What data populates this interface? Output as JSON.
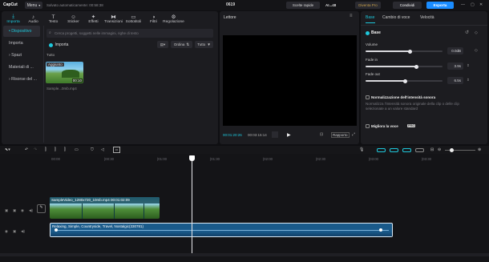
{
  "app": {
    "name": "CapCut",
    "menu": "Menu",
    "status": "Salvato automaticamente: 00:58:38",
    "project": "0619",
    "shortcuts": "Scelte rapide",
    "user": "AI...48",
    "pro": "Diventa Pro",
    "share": "Condividi",
    "export": "Esporta"
  },
  "toolbar": [
    {
      "label": "Importa",
      "icon": "download-icon"
    },
    {
      "label": "Audio",
      "icon": "audio-icon"
    },
    {
      "label": "Testo",
      "icon": "text-icon"
    },
    {
      "label": "Sticker",
      "icon": "sticker-icon"
    },
    {
      "label": "Effetti",
      "icon": "effects-icon"
    },
    {
      "label": "Transizioni",
      "icon": "transition-icon"
    },
    {
      "label": "Sottotitoli",
      "icon": "subtitles-icon"
    },
    {
      "label": "Filtri",
      "icon": "filter-icon"
    },
    {
      "label": "Regolazione",
      "icon": "adjust-icon"
    }
  ],
  "sidebar": [
    {
      "label": "• Dispositivo"
    },
    {
      "label": "Importa"
    },
    {
      "label": "› Spazi"
    },
    {
      "label": "Materiali di ..."
    },
    {
      "label": "› Risorse del ..."
    }
  ],
  "media": {
    "search_placeholder": "Cerca progetti, soggetti nelle immagini, righe di testo",
    "import": "Importa",
    "sort": "Ordina",
    "all": "Tutto",
    "filter": "Tutto",
    "added": "Aggiunto",
    "duration": "00:10",
    "filename": "Sample...0mb.mp4"
  },
  "player": {
    "title": "Lettore",
    "current": "00:01:20:26",
    "total": "00:03:15:14",
    "ratio": "Rapporto"
  },
  "props": {
    "tabs": [
      "Base",
      "Cambio di voce",
      "Velocità"
    ],
    "section": "Base",
    "volume_label": "Volume",
    "volume_value": "0.0dB",
    "volume_level": 0.58,
    "fadein_label": "Fade in",
    "fadein_value": "3.9s",
    "fadein_level": 0.66,
    "fadeout_label": "Fade out",
    "fadeout_value": "6.5s",
    "fadeout_level": 0.52,
    "normalize_title": "Normalizzazione dell'intensità sonora",
    "normalize_desc": "Normalizza l'intensità sonora originale della clip o delle clip selezionate a un valore standard",
    "enhance_title": "Migliora la voce",
    "pro_badge": "PRO"
  },
  "timeline": {
    "ruler": [
      "00:00",
      "|00:30",
      "|01:00",
      "|01:30",
      "|02:00",
      "|02:30",
      "|03:00",
      "|03:30"
    ],
    "video_clip": "SampleVideo_1280x720_10mb.mp4  00:01:02:09",
    "audio_clip": "Relaxing, Simple, Countryside, Travel, Nostalgic(330781)",
    "playhead_time": "01:20"
  },
  "colors": {
    "accent": "#1ec8dc",
    "export": "#1a8cff",
    "pro": "#c7a04a"
  }
}
